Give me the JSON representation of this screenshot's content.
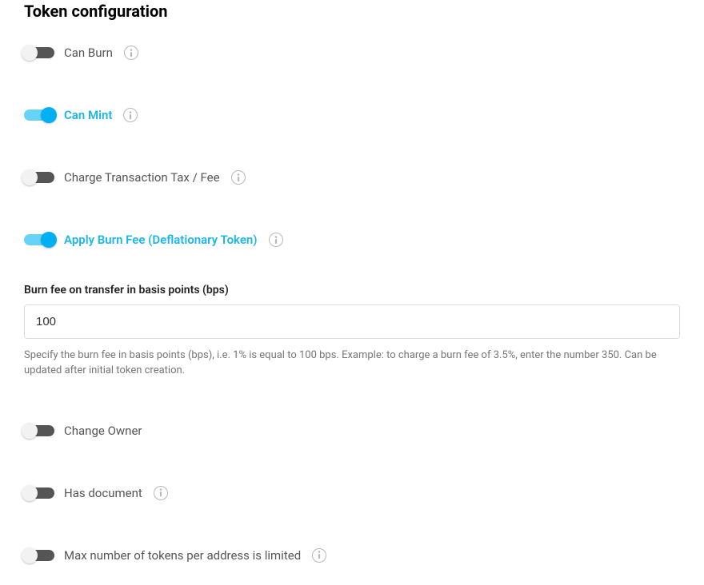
{
  "title": "Token configuration",
  "toggles": {
    "can_burn": {
      "label": "Can Burn",
      "on": false,
      "has_info": true
    },
    "can_mint": {
      "label": "Can Mint",
      "on": true,
      "has_info": true
    },
    "charge_tax": {
      "label": "Charge Transaction Tax / Fee",
      "on": false,
      "has_info": true
    },
    "apply_burn_fee": {
      "label": "Apply Burn Fee (Deflationary Token)",
      "on": true,
      "has_info": true
    },
    "change_owner": {
      "label": "Change Owner",
      "on": false,
      "has_info": false
    },
    "has_document": {
      "label": "Has document",
      "on": false,
      "has_info": true
    },
    "max_tokens_limited": {
      "label": "Max number of tokens per address is limited",
      "on": false,
      "has_info": true
    }
  },
  "burn_fee_field": {
    "label": "Burn fee on transfer in basis points (bps)",
    "value": "100",
    "help": "Specify the burn fee in basis points (bps), i.e. 1% is equal to 100 bps. Example: to charge a burn fee of 3.5%, enter the number 350. Can be updated after initial token creation."
  }
}
